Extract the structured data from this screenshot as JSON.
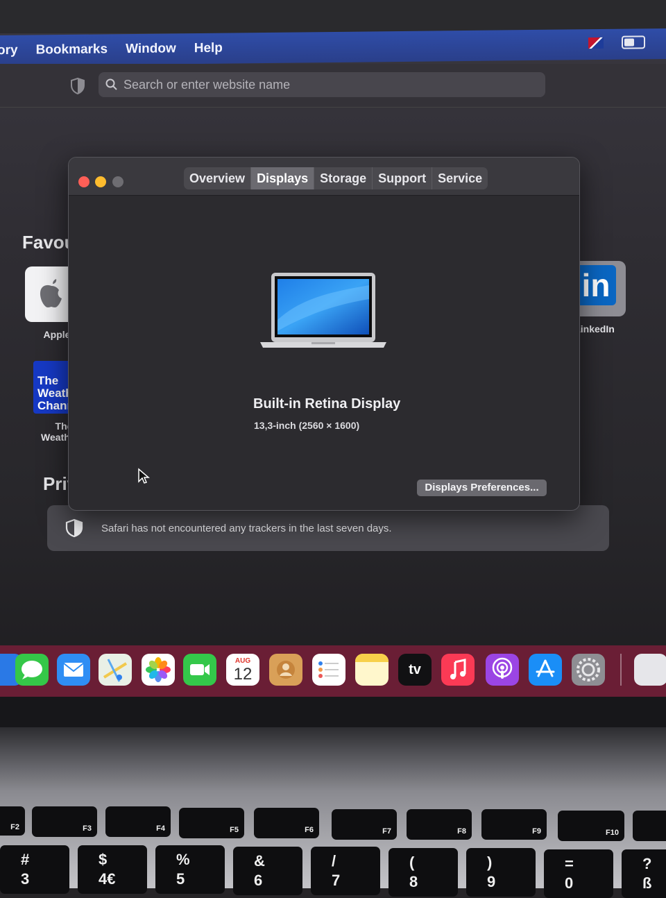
{
  "menubar": {
    "items": [
      "ory",
      "Bookmarks",
      "Window",
      "Help"
    ]
  },
  "search": {
    "placeholder": "Search or enter website name"
  },
  "start_page": {
    "favourites_title": "Favou",
    "favourites": [
      {
        "label": "Apple"
      },
      {
        "tile_text": "The Weather Channel",
        "label": "The Weather..."
      },
      {
        "label": "LinkedIn",
        "tile_text": "in"
      }
    ],
    "privacy_title": "Privac",
    "privacy_message": "Safari has not encountered any trackers in the last seven days."
  },
  "about_window": {
    "tabs": [
      {
        "label": "Overview",
        "active": false
      },
      {
        "label": "Displays",
        "active": true
      },
      {
        "label": "Storage",
        "active": false
      },
      {
        "label": "Support",
        "active": false
      },
      {
        "label": "Service",
        "active": false
      }
    ],
    "display_name": "Built-in Retina Display",
    "display_size": "13,3-inch (2560 × 1600)",
    "preferences_button": "Displays Preferences..."
  },
  "dock": {
    "calendar_month": "AUG",
    "calendar_day": "12",
    "tv_label": "tv"
  },
  "keyboard": {
    "fn_keys": [
      "F2",
      "F3",
      "F4",
      "F5",
      "F6",
      "F7",
      "F8",
      "F9",
      "F10"
    ],
    "num_keys": [
      {
        "top": "#",
        "bottom": "3"
      },
      {
        "top": "$",
        "bottom": "4€"
      },
      {
        "top": "%",
        "bottom": "5"
      },
      {
        "top": "&",
        "bottom": "6"
      },
      {
        "top": "/",
        "bottom": "7"
      },
      {
        "top": "(",
        "bottom": "8"
      },
      {
        "top": ")",
        "bottom": "9"
      },
      {
        "top": "=",
        "bottom": "0"
      },
      {
        "top": "?",
        "bottom": "ß"
      }
    ]
  },
  "colors": {
    "menubar": "#2f4da8",
    "dock": "#6a1e35",
    "active_tab": "#6b6a70"
  }
}
